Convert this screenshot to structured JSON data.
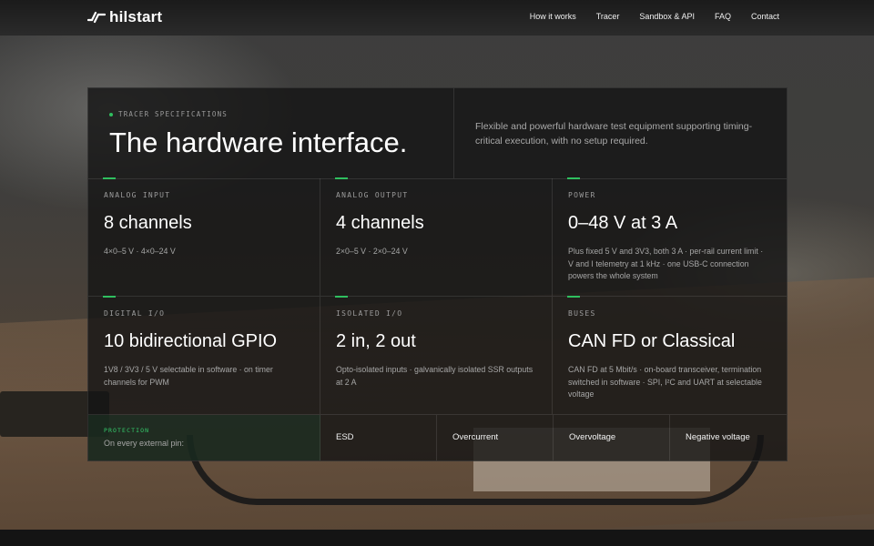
{
  "brand": {
    "name": "hilstart",
    "logo_icon": "slash-waveform-icon"
  },
  "nav": {
    "items": [
      "How it works",
      "Tracer",
      "Sandbox & API",
      "FAQ",
      "Contact"
    ]
  },
  "hero": {
    "eyebrow": "TRACER SPECIFICATIONS",
    "title": "The hardware interface.",
    "description": "Flexible and powerful hardware test equipment supporting timing-critical execution, with no setup required."
  },
  "specs": [
    {
      "label": "ANALOG INPUT",
      "value": "8 channels",
      "detail": "4×0–5 V · 4×0–24 V"
    },
    {
      "label": "ANALOG OUTPUT",
      "value": "4 channels",
      "detail": "2×0–5 V · 2×0–24 V"
    },
    {
      "label": "POWER",
      "value": "0–48 V at 3 A",
      "detail": "Plus fixed 5 V and 3V3, both 3 A · per-rail current limit · V and I telemetry at 1 kHz · one USB-C connection powers the whole system"
    },
    {
      "label": "DIGITAL I/O",
      "value": "10 bidirectional GPIO",
      "detail": "1V8 / 3V3 / 5 V selectable in software · on timer channels for PWM"
    },
    {
      "label": "ISOLATED I/O",
      "value": "2 in, 2 out",
      "detail": "Opto-isolated inputs · galvanically isolated SSR outputs at 2 A"
    },
    {
      "label": "BUSES",
      "value": "CAN FD or Classical",
      "detail": "CAN FD at 5 Mbit/s · on-board transceiver, termination switched in software · SPI, I²C and UART at selectable voltage"
    }
  ],
  "protection": {
    "tag": "PROTECTION",
    "subtitle": "On every external pin:",
    "items": [
      "ESD",
      "Overcurrent",
      "Overvoltage",
      "Negative voltage"
    ]
  },
  "colors": {
    "accent": "#2fbf5f",
    "text": "#ffffff",
    "muted": "#a6a6a6"
  }
}
